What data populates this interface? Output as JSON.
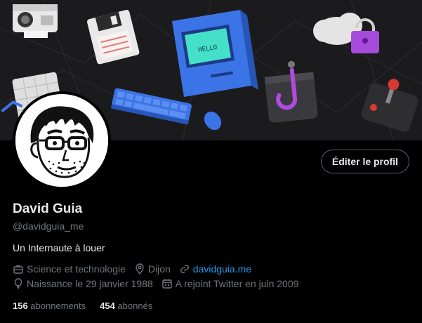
{
  "profile": {
    "name": "David Guia",
    "handle": "@davidguia_me",
    "bio": "Un Internaute à louer",
    "edit_label": "Éditer le profil",
    "category": "Science et technologie",
    "location": "Dijon",
    "website": "davidguia.me",
    "birthday": "Naissance le 29 janvier 1988",
    "joined": "A rejoint Twitter en juin 2009",
    "following_count": "156",
    "following_label": "abonnements",
    "followers_count": "454",
    "followers_label": "abonnés"
  },
  "banner": {
    "screen_text": "HELLO",
    "icons": [
      "instant-camera-icon",
      "floppy-disk-icon",
      "retro-computer-icon",
      "cloud-lock-icon",
      "grid-chart-icon",
      "keyboard-icon",
      "mouse-icon",
      "hook-app-icon",
      "joystick-icon"
    ]
  },
  "colors": {
    "background": "#000000",
    "text": "#e7e9ea",
    "muted": "#71767b",
    "link": "#1d9bf0",
    "border": "#536471"
  }
}
